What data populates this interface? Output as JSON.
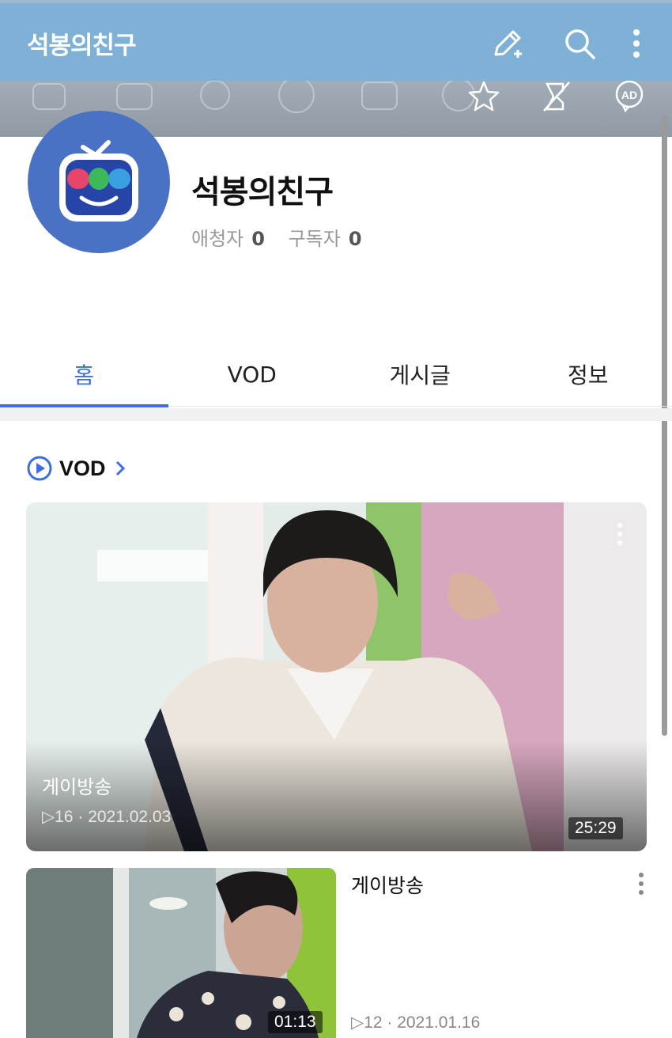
{
  "header": {
    "title": "석봉의친구"
  },
  "channel": {
    "name": "석봉의친구",
    "viewers_label": "애청자",
    "viewers_count": "0",
    "subscribers_label": "구독자",
    "subscribers_count": "0"
  },
  "banner_actions": {
    "ad_label": "AD"
  },
  "tabs": [
    {
      "label": "홈",
      "active": true
    },
    {
      "label": "VOD",
      "active": false
    },
    {
      "label": "게시글",
      "active": false
    },
    {
      "label": "정보",
      "active": false
    }
  ],
  "vod_section": {
    "title": "VOD"
  },
  "videos": [
    {
      "title": "게이방송",
      "views": "16",
      "date": "2021.02.03",
      "duration": "25:29"
    },
    {
      "title": "게이방송",
      "views": "12",
      "date": "2021.01.16",
      "duration": "01:13"
    }
  ],
  "colors": {
    "accent": "#3d6de0",
    "topbar": "#7fb0d6",
    "avatar_bg": "#4a72c4"
  },
  "icons": [
    "edit-icon",
    "search-icon",
    "more-vertical-icon",
    "star-icon",
    "mute-icon",
    "ad-icon",
    "play-circle-icon",
    "chevron-right-icon"
  ]
}
